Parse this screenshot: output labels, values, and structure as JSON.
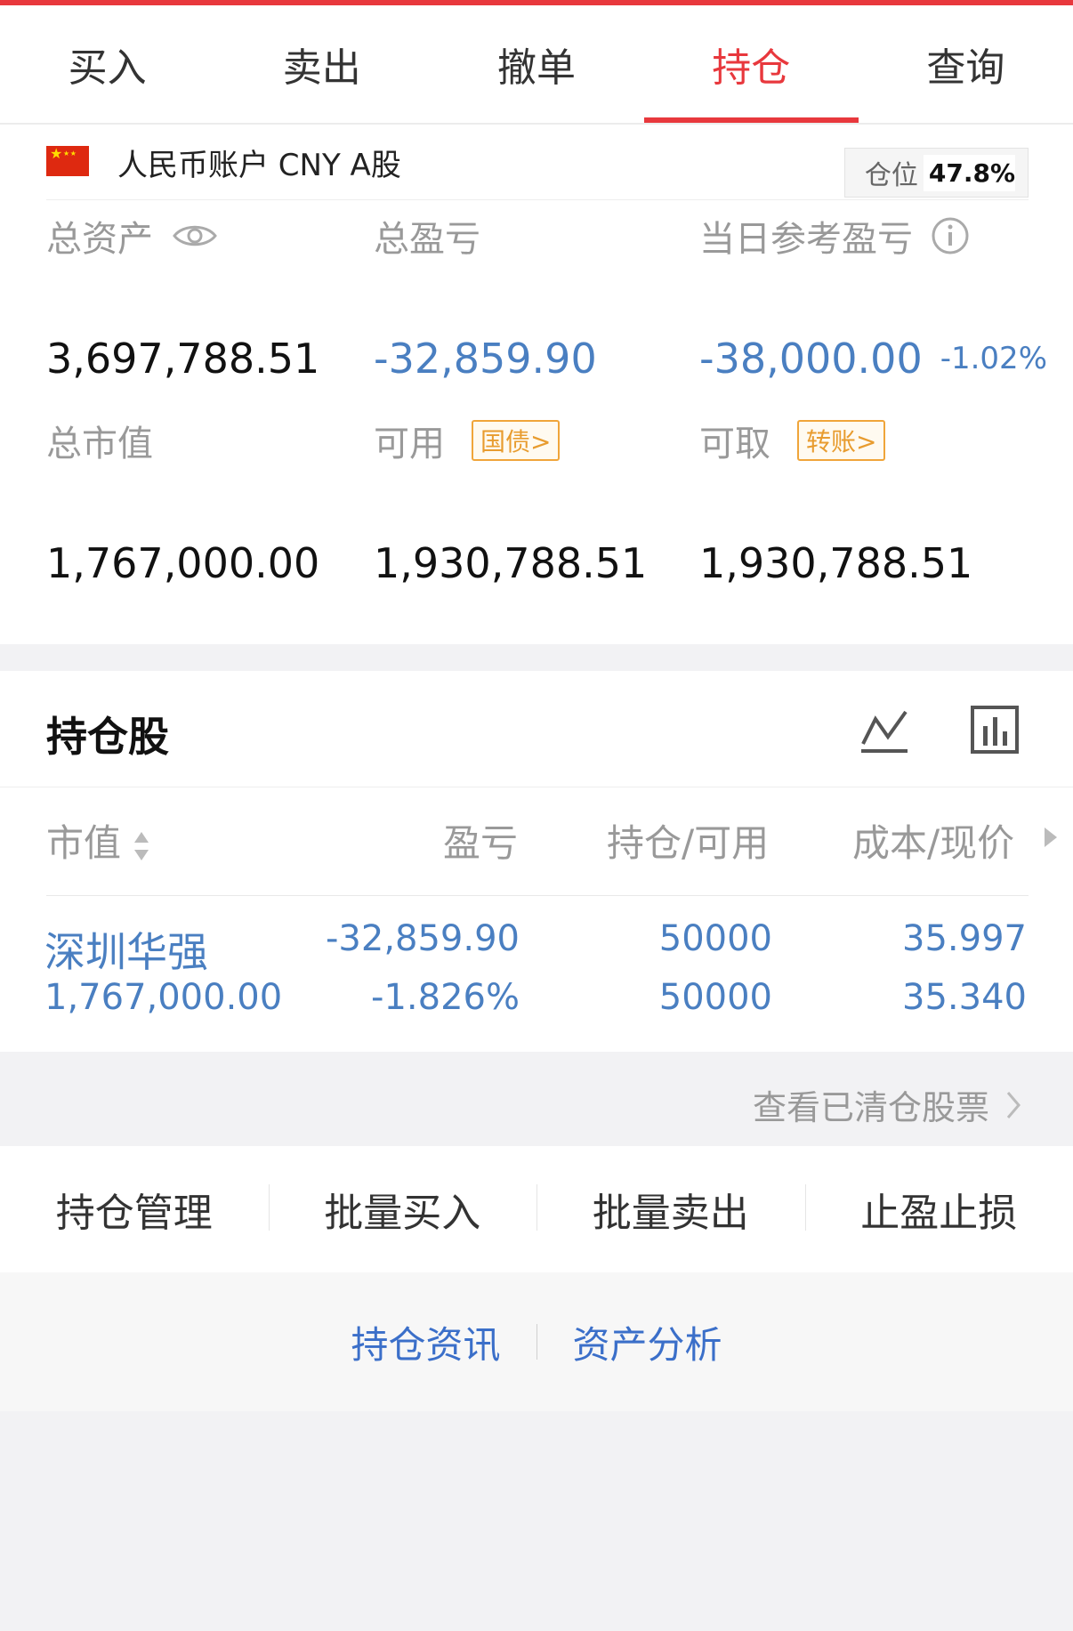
{
  "colors": {
    "accent": "#e8383d",
    "blue_value": "#4a7fc1",
    "tag": "#e89c2f",
    "link": "#3b6fc9"
  },
  "tabs": [
    {
      "label": "买入"
    },
    {
      "label": "卖出"
    },
    {
      "label": "撤单"
    },
    {
      "label": "持仓",
      "active": true
    },
    {
      "label": "查询"
    }
  ],
  "account": {
    "flag_icon": "cn-flag-icon",
    "name": "人民币账户 CNY A股",
    "position_label": "仓位",
    "position_pct": "47.8%"
  },
  "summary": {
    "total_assets_label": "总资产",
    "total_assets": "3,697,788.51",
    "total_pl_label": "总盈亏",
    "total_pl": "-32,859.90",
    "daily_pl_label": "当日参考盈亏",
    "daily_pl": "-38,000.00",
    "daily_pl_pct": "-1.02%",
    "market_value_label": "总市值",
    "market_value": "1,767,000.00",
    "available_label": "可用",
    "available_tag": "国债>",
    "available": "1,930,788.51",
    "withdrawable_label": "可取",
    "withdrawable_tag": "转账>",
    "withdrawable": "1,930,788.51"
  },
  "holdings": {
    "title": "持仓股",
    "columns": {
      "market_value": "市值",
      "pl": "盈亏",
      "qty": "持仓/可用",
      "price": "成本/现价"
    },
    "rows": [
      {
        "name": "深圳华强",
        "market_value": "1,767,000.00",
        "pl": "-32,859.90",
        "pl_pct": "-1.826%",
        "qty_hold": "50000",
        "qty_avail": "50000",
        "cost": "35.997",
        "price": "35.340"
      }
    ]
  },
  "cleared_link": "查看已清仓股票",
  "actions": [
    {
      "label": "持仓管理"
    },
    {
      "label": "批量买入"
    },
    {
      "label": "批量卖出"
    },
    {
      "label": "止盈止损"
    }
  ],
  "bottom_links": [
    {
      "label": "持仓资讯"
    },
    {
      "label": "资产分析"
    }
  ]
}
